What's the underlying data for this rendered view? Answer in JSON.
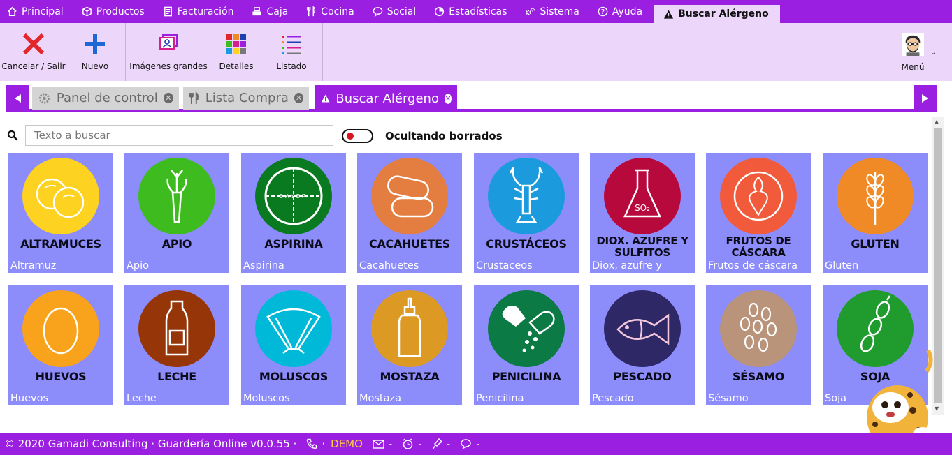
{
  "menu": {
    "items": [
      {
        "label": "Principal",
        "icon": "home-icon"
      },
      {
        "label": "Productos",
        "icon": "cube-icon"
      },
      {
        "label": "Facturación",
        "icon": "invoice-icon"
      },
      {
        "label": "Caja",
        "icon": "cash-register-icon"
      },
      {
        "label": "Cocina",
        "icon": "cutlery-icon"
      },
      {
        "label": "Social",
        "icon": "chat-icon"
      },
      {
        "label": "Estadísticas",
        "icon": "globe-chart-icon"
      },
      {
        "label": "Sistema",
        "icon": "gears-icon"
      },
      {
        "label": "Ayuda",
        "icon": "question-icon"
      },
      {
        "label": "Buscar Alérgeno",
        "icon": "warning-icon",
        "active": true
      }
    ]
  },
  "toolbar": {
    "cancel_label": "Cancelar / Salir",
    "new_label": "Nuevo",
    "big_images_label": "Imágenes grandes",
    "details_label": "Detalles",
    "list_label": "Listado",
    "menu_label": "Menú"
  },
  "tabs": [
    {
      "label": "Panel de control",
      "active": false
    },
    {
      "label": "Lista Compra",
      "active": false
    },
    {
      "label": "Buscar Alérgeno",
      "active": true
    }
  ],
  "search": {
    "placeholder": "Texto a buscar",
    "toggle_label": "Ocultando borrados"
  },
  "allergens": [
    {
      "caps": "ALTRAMUCES",
      "name": "Altramuz",
      "color": "#fdd221"
    },
    {
      "caps": "APIO",
      "name": "Apio",
      "color": "#3dbb1f"
    },
    {
      "caps": "ASPIRINA",
      "name": "Aspirina",
      "color": "#0a7a20"
    },
    {
      "caps": "CACAHUETES",
      "name": "Cacahuetes",
      "color": "#e37d40"
    },
    {
      "caps": "CRUSTÁCEOS",
      "name": "Crustaceos",
      "color": "#1c9ade"
    },
    {
      "caps": "DIOX. AZUFRE Y SULFITOS",
      "name": "Diox, azufre y",
      "color": "#b8093d"
    },
    {
      "caps": "FRUTOS DE CÁSCARA",
      "name": "Frutos de cáscara",
      "color": "#f15a3b"
    },
    {
      "caps": "GLUTEN",
      "name": "Gluten",
      "color": "#f08a26"
    },
    {
      "caps": "HUEVOS",
      "name": "Huevos",
      "color": "#f8a31b"
    },
    {
      "caps": "LECHE",
      "name": "Leche",
      "color": "#963508"
    },
    {
      "caps": "MOLUSCOS",
      "name": "Moluscos",
      "color": "#00b9d9"
    },
    {
      "caps": "MOSTAZA",
      "name": "Mostaza",
      "color": "#dc9a25"
    },
    {
      "caps": "PENICILINA",
      "name": "Penicilina",
      "color": "#0b7a45"
    },
    {
      "caps": "PESCADO",
      "name": "Pescado",
      "color": "#2e2866"
    },
    {
      "caps": "SÉSAMO",
      "name": "Sésamo",
      "color": "#b9947a"
    },
    {
      "caps": "SOJA",
      "name": "Soja",
      "color": "#1f9c2d"
    }
  ],
  "footer": {
    "copyright": "© 2020 Gamadi Consulting · Guardería Online v0.0.55 ·",
    "demo": "DEMO",
    "dash1": "-",
    "dash2": "-",
    "dash3": "-",
    "dash4": "-"
  },
  "colors": {
    "accent": "#9a1fe0",
    "toolbar_bg": "#ecd6fa",
    "card_bg": "#8d8cfb"
  }
}
